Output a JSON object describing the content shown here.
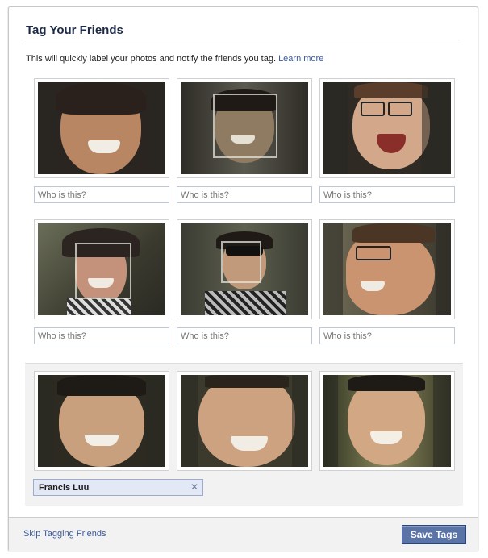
{
  "dialog": {
    "title": "Tag Your Friends",
    "intro_text": "This will quickly label your photos and notify the friends you tag.",
    "learn_more": "Learn more"
  },
  "faces": [
    {
      "placeholder": "Who is this?",
      "value": ""
    },
    {
      "placeholder": "Who is this?",
      "value": ""
    },
    {
      "placeholder": "Who is this?",
      "value": ""
    },
    {
      "placeholder": "Who is this?",
      "value": ""
    },
    {
      "placeholder": "Who is this?",
      "value": ""
    },
    {
      "placeholder": "Who is this?",
      "value": ""
    }
  ],
  "selected_group": {
    "tagged_name": "Francis Luu",
    "remove_glyph": "✕"
  },
  "footer": {
    "skip_label": "Skip Tagging Friends",
    "save_label": "Save Tags"
  },
  "colors": {
    "link": "#3b5998",
    "title": "#1c2a47",
    "button_bg": "#5b74a8",
    "token_bg": "#e2e8f6"
  }
}
